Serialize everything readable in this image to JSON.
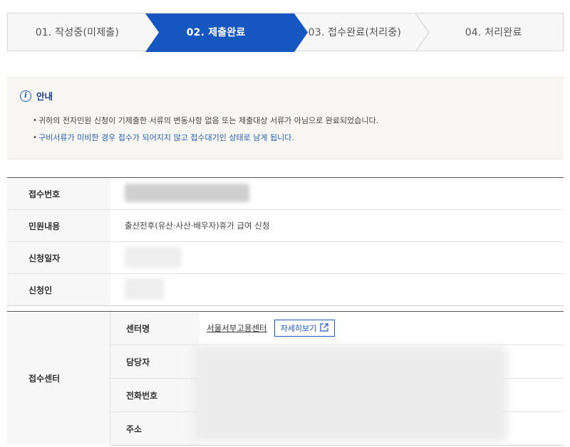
{
  "steps": [
    {
      "label": "01. 작성중(미제출)",
      "state": "done"
    },
    {
      "label": "02. 제출완료",
      "state": "active"
    },
    {
      "label": "03. 접수완료(처리중)",
      "state": "pending"
    },
    {
      "label": "04. 처리완료",
      "state": "pending"
    }
  ],
  "colors": {
    "accent": "#1a57c7",
    "active_step": "#1556c0",
    "label_bg": "#f7f7f7"
  },
  "notice": {
    "icon": "info-icon",
    "title": "안내",
    "items": [
      "귀하의 전자민원 신청이 기제출한 서류의 변동사항 없음 또는 제출대상 서류가 아님으로 완료되었습니다.",
      "구비서류가 미비한 경우 접수가 되어지지 않고 접수대기인 상태로 남게 됩니다."
    ]
  },
  "info": {
    "receipt_no_label": "접수번호",
    "content_label": "민원내용",
    "content_value": "출산전후(유산·사산·배우자)휴가 급여 신청",
    "date_label": "신청일자",
    "applicant_label": "신청인"
  },
  "center": {
    "label": "접수센터",
    "name_label": "센터명",
    "name_value": "서울서부고용센터",
    "detail_button": "자세히보기",
    "detail_icon": "external-link-icon",
    "manager_label": "담당자",
    "phone_label": "전화번호",
    "address_label": "주소"
  }
}
